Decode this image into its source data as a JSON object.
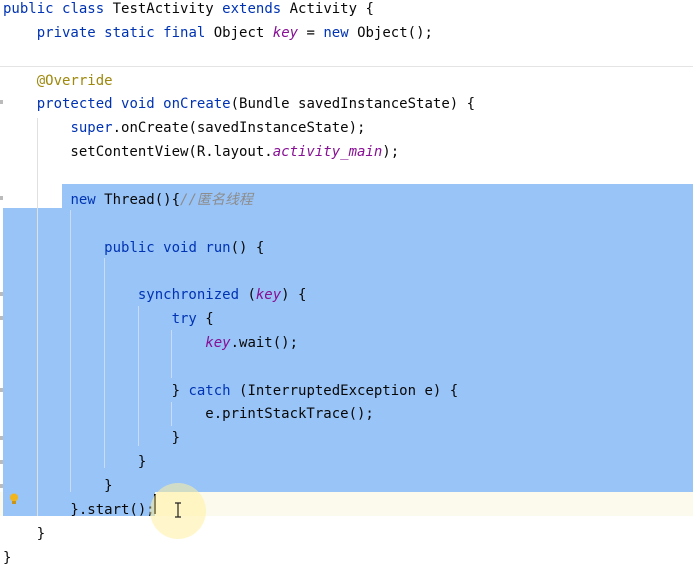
{
  "editor": {
    "lines": [
      {
        "id": "l1",
        "tokens": [
          {
            "t": "public ",
            "c": "kw"
          },
          {
            "t": "class ",
            "c": "kw"
          },
          {
            "t": "TestActivity ",
            "c": ""
          },
          {
            "t": "extends ",
            "c": "kw"
          },
          {
            "t": "Activity {",
            "c": ""
          }
        ]
      },
      {
        "id": "l2",
        "tokens": [
          {
            "t": "    ",
            "c": ""
          },
          {
            "t": "private ",
            "c": "kw"
          },
          {
            "t": "static ",
            "c": "kw"
          },
          {
            "t": "final ",
            "c": "kw"
          },
          {
            "t": "Object ",
            "c": ""
          },
          {
            "t": "key",
            "c": "fld"
          },
          {
            "t": " = ",
            "c": ""
          },
          {
            "t": "new ",
            "c": "kw"
          },
          {
            "t": "Object();",
            "c": ""
          }
        ]
      },
      {
        "id": "l3",
        "tokens": []
      },
      {
        "id": "l4",
        "tokens": [
          {
            "t": "    ",
            "c": ""
          },
          {
            "t": "@Override",
            "c": "ann"
          }
        ]
      },
      {
        "id": "l5",
        "tokens": [
          {
            "t": "    ",
            "c": ""
          },
          {
            "t": "protected ",
            "c": "kw"
          },
          {
            "t": "void ",
            "c": "kw"
          },
          {
            "t": "onCreate",
            "c": "kw"
          },
          {
            "t": "(Bundle savedInstanceState) {",
            "c": ""
          }
        ]
      },
      {
        "id": "l6",
        "tokens": [
          {
            "t": "        ",
            "c": ""
          },
          {
            "t": "super",
            "c": "kw"
          },
          {
            "t": ".onCreate(savedInstanceState);",
            "c": ""
          }
        ]
      },
      {
        "id": "l7",
        "tokens": [
          {
            "t": "        setContentView(R.layout.",
            "c": ""
          },
          {
            "t": "activity_main",
            "c": "fld"
          },
          {
            "t": ");",
            "c": ""
          }
        ]
      },
      {
        "id": "l8",
        "tokens": []
      },
      {
        "id": "l9",
        "tokens": [
          {
            "t": "        ",
            "c": ""
          },
          {
            "t": "new ",
            "c": "kw"
          },
          {
            "t": "Thread(){",
            "c": ""
          },
          {
            "t": "//匿名线程",
            "c": "cmt"
          }
        ]
      },
      {
        "id": "l10",
        "tokens": []
      },
      {
        "id": "l11",
        "tokens": [
          {
            "t": "            ",
            "c": ""
          },
          {
            "t": "public ",
            "c": "kw"
          },
          {
            "t": "void ",
            "c": "kw"
          },
          {
            "t": "run",
            "c": "kw"
          },
          {
            "t": "() {",
            "c": ""
          }
        ]
      },
      {
        "id": "l12",
        "tokens": []
      },
      {
        "id": "l13",
        "tokens": [
          {
            "t": "                ",
            "c": ""
          },
          {
            "t": "synchronized ",
            "c": "kw"
          },
          {
            "t": "(",
            "c": ""
          },
          {
            "t": "key",
            "c": "fld"
          },
          {
            "t": ") {",
            "c": ""
          }
        ]
      },
      {
        "id": "l14",
        "tokens": [
          {
            "t": "                    ",
            "c": ""
          },
          {
            "t": "try ",
            "c": "kw"
          },
          {
            "t": "{",
            "c": ""
          }
        ]
      },
      {
        "id": "l15",
        "tokens": [
          {
            "t": "                        ",
            "c": ""
          },
          {
            "t": "key",
            "c": "fld"
          },
          {
            "t": ".wait();",
            "c": ""
          }
        ]
      },
      {
        "id": "l16",
        "tokens": []
      },
      {
        "id": "l17",
        "tokens": [
          {
            "t": "                    } ",
            "c": ""
          },
          {
            "t": "catch ",
            "c": "kw"
          },
          {
            "t": "(InterruptedException e) {",
            "c": ""
          }
        ]
      },
      {
        "id": "l18",
        "tokens": [
          {
            "t": "                        e.printStackTrace();",
            "c": ""
          }
        ]
      },
      {
        "id": "l19",
        "tokens": [
          {
            "t": "                    }",
            "c": ""
          }
        ]
      },
      {
        "id": "l20",
        "tokens": [
          {
            "t": "                }",
            "c": ""
          }
        ]
      },
      {
        "id": "l21",
        "tokens": [
          {
            "t": "            }",
            "c": ""
          }
        ]
      },
      {
        "id": "l22",
        "tokens": [
          {
            "t": "        }.start();",
            "c": ""
          }
        ]
      },
      {
        "id": "l23",
        "tokens": [
          {
            "t": "    }",
            "c": ""
          }
        ]
      },
      {
        "id": "l24",
        "tokens": [
          {
            "t": "}",
            "c": ""
          }
        ]
      }
    ]
  },
  "icons": {
    "intention": "lightbulb-icon",
    "cursor": "text-cursor-icon"
  },
  "colors": {
    "keyword": "#0033b3",
    "field": "#871094",
    "annotation": "#9e880d",
    "comment": "#8c8c8c",
    "selection": "#99c4f7",
    "current_line": "#fcfaed"
  }
}
